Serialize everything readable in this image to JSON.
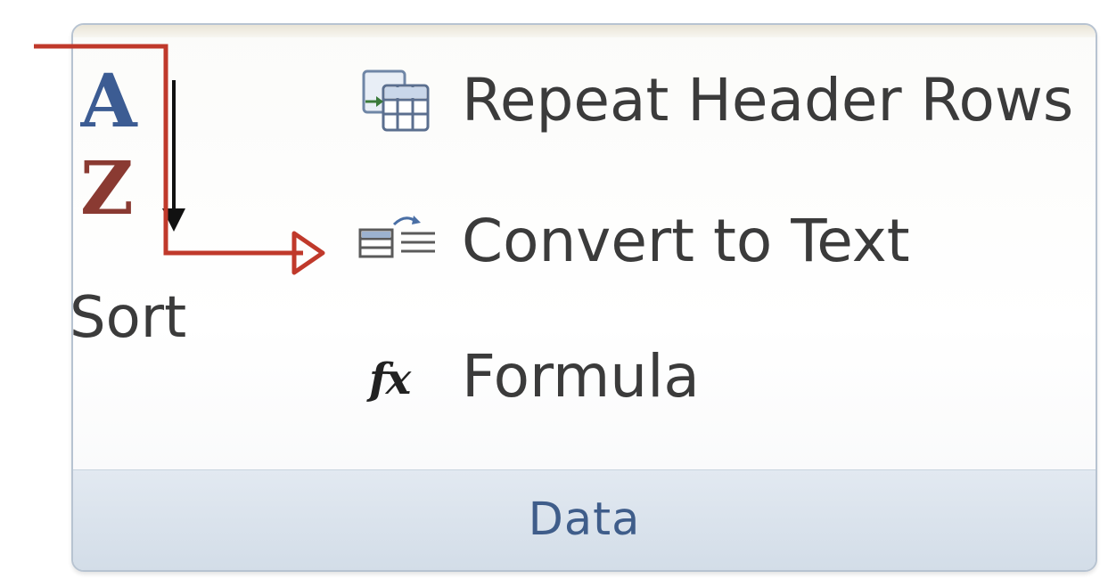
{
  "ribbon_group": {
    "label": "Data",
    "sort": {
      "label": "Sort",
      "icon": "sort-a-to-z-icon",
      "letter_top": "A",
      "letter_bottom": "Z"
    },
    "commands": [
      {
        "id": "repeat-header-rows",
        "label": "Repeat Header Rows",
        "icon": "repeat-header-rows-icon"
      },
      {
        "id": "convert-to-text",
        "label": "Convert to Text",
        "icon": "convert-to-text-icon"
      },
      {
        "id": "formula",
        "label": "Formula",
        "icon": "formula-fx-icon",
        "icon_glyph": "fx"
      }
    ]
  },
  "colors": {
    "annotation_arrow": "#c0392b",
    "label_blue": "#3f5d8a",
    "letter_a_blue": "#3c5c93",
    "letter_z_red": "#8a3a32"
  }
}
